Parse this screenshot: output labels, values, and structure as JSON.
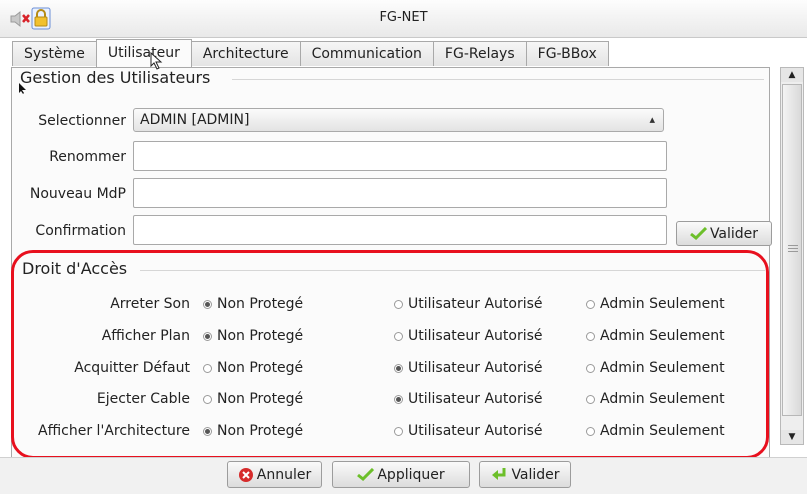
{
  "window": {
    "title": "FG-NET"
  },
  "tabs": [
    {
      "label": "Système"
    },
    {
      "label": "Utilisateur"
    },
    {
      "label": "Architecture"
    },
    {
      "label": "Communication"
    },
    {
      "label": "FG-Relays"
    },
    {
      "label": "FG-BBox"
    }
  ],
  "user_section": {
    "title": "Gestion des Utilisateurs",
    "select_label": "Selectionner",
    "select_value": "ADMIN [ADMIN]",
    "rename_label": "Renommer",
    "rename_value": "",
    "new_password_label": "Nouveau MdP",
    "new_password_value": "",
    "confirm_label": "Confirmation",
    "confirm_value": "",
    "validate_label": "Valider"
  },
  "access_section": {
    "title": "Droit d'Accès",
    "options": [
      "Non Protegé",
      "Utilisateur Autorisé",
      "Admin Seulement"
    ],
    "rows": [
      {
        "label": "Arreter Son",
        "selected": 0
      },
      {
        "label": "Afficher Plan",
        "selected": 0
      },
      {
        "label": "Acquitter Défaut",
        "selected": 1
      },
      {
        "label": "Ejecter Cable",
        "selected": 1
      },
      {
        "label": "Afficher l'Architecture",
        "selected": 0
      }
    ]
  },
  "footer": {
    "cancel_label": "Annuler",
    "apply_label": "Appliquer",
    "validate_label": "Valider"
  },
  "colors": {
    "highlight": "#e8101e",
    "check_green": "#6cbf2a",
    "cancel_red": "#d62b2b"
  },
  "icons": [
    "speaker-muted-icon",
    "lock-icon",
    "check-icon",
    "cancel-icon",
    "return-arrow-icon",
    "mouse-cursor-icon"
  ]
}
